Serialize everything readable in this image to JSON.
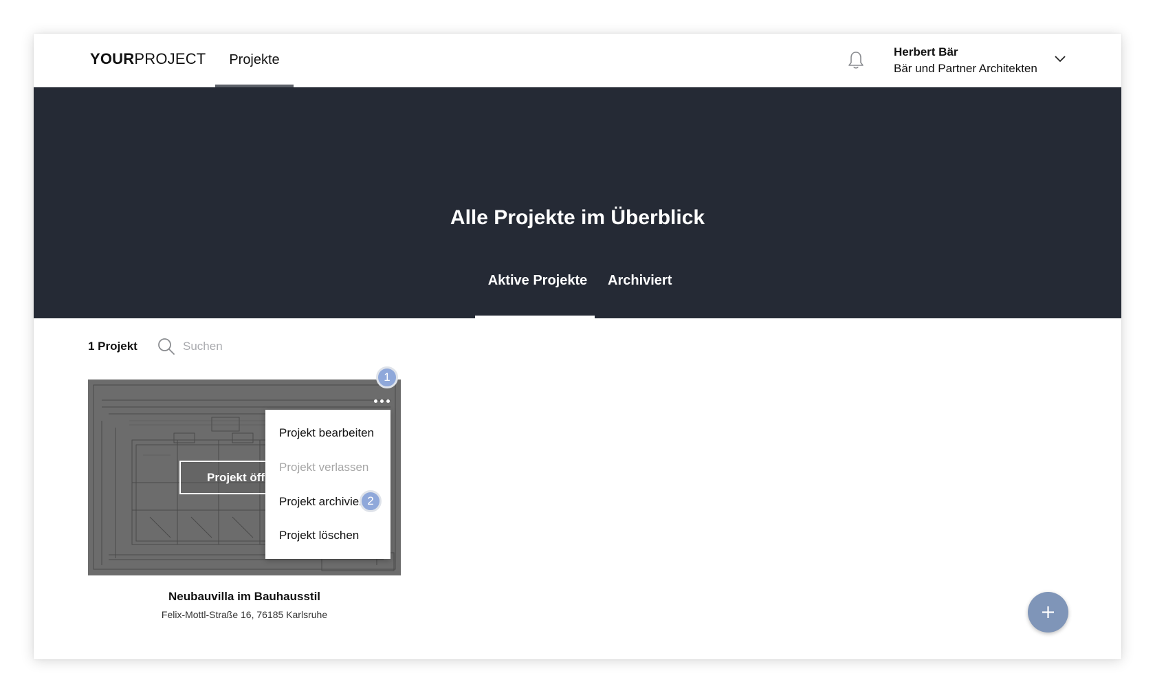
{
  "header": {
    "logo_bold": "YOUR",
    "logo_light": "PROJECT",
    "nav_tab": "Projekte",
    "user_name": "Herbert Bär",
    "user_company": "Bär und Partner Architekten"
  },
  "hero": {
    "title": "Alle Projekte im Überblick",
    "tabs": [
      {
        "label": "Aktive Projekte",
        "active": true
      },
      {
        "label": "Archiviert",
        "active": false
      }
    ]
  },
  "toolbar": {
    "count": "1 Projekt",
    "search_placeholder": "Suchen"
  },
  "project_card": {
    "open_label": "Projekt öffnen",
    "title": "Neubauvilla im Bauhausstil",
    "address": "Felix-Mottl-Straße 16, 76185 Karlsruhe"
  },
  "context_menu": {
    "items": [
      {
        "label": "Projekt bearbeiten",
        "disabled": false
      },
      {
        "label": "Projekt verlassen",
        "disabled": true
      },
      {
        "label": "Projekt archivieren",
        "disabled": false
      },
      {
        "label": "Projekt löschen",
        "disabled": false
      }
    ]
  },
  "badges": {
    "step1": "1",
    "step2": "2"
  },
  "colors": {
    "hero_background": "#252a35",
    "badge": "#8fa8da",
    "fab": "#7f95b8",
    "disabled_text": "#a6a6a6"
  },
  "icons": {
    "notifications": "bell-icon",
    "user_menu": "chevron-down-icon",
    "search": "search-icon",
    "card_options": "more-horizontal-icon",
    "add_project": "plus-icon"
  }
}
